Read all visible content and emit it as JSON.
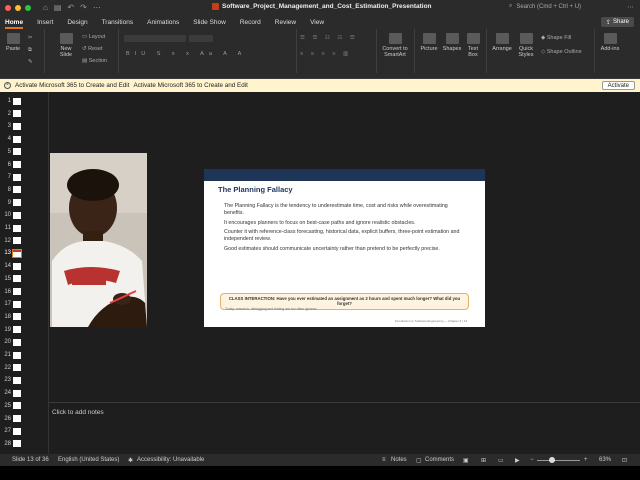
{
  "window": {
    "title": "Software_Project_Management_and_Cost_Estimation_Presentation",
    "search_placeholder": "Search (Cmd + Ctrl + U)"
  },
  "ribbon_tabs": [
    "Home",
    "Insert",
    "Design",
    "Transitions",
    "Animations",
    "Slide Show",
    "Record",
    "Review",
    "View"
  ],
  "share_label": "Share",
  "ribbon": {
    "paste": "Paste",
    "new_slide": "New Slide",
    "layout": "Layout",
    "reset": "Reset",
    "section": "Section",
    "convert": "Convert to SmartArt",
    "picture": "Picture",
    "shapes": "Shapes",
    "text_box": "Text Box",
    "arrange": "Arrange",
    "quick_styles": "Quick Styles",
    "shape_fill": "Shape Fill",
    "shape_outline": "Shape Outline",
    "add_ins": "Add-ins"
  },
  "infobar": {
    "message": "Activate Microsoft 365 to Create and Edit",
    "message2": "Activate Microsoft 365 to Create and Edit",
    "button": "Activate"
  },
  "thumbnails": [
    "1",
    "2",
    "3",
    "4",
    "5",
    "6",
    "7",
    "8",
    "9",
    "10",
    "11",
    "12",
    "13",
    "14",
    "15",
    "16",
    "17",
    "18",
    "19",
    "20",
    "21",
    "22",
    "23",
    "24",
    "25",
    "26",
    "27",
    "28"
  ],
  "selected_slide": 13,
  "slide": {
    "title": "The Planning Fallacy",
    "bullets": [
      "The Planning Fallacy is the tendency to underestimate time, cost and risks while overestimating benefits.",
      "It encourages planners to focus on best-case paths and ignore realistic obstacles.",
      "Counter it with reference-class forecasting, historical data, explicit buffers, three-point estimation and independent review.",
      "Good estimates should communicate uncertainty rather than pretend to be perfectly precise."
    ],
    "interaction_title": "CLASS INTERACTION: Have you ever estimated an assignment as 2 hours and spent much longer? What did you forget?",
    "interaction_sub": "Today, research, debugging and testing are too often ignored.",
    "footer": "Introduction to Software Engineering — Chapter 3 | 13"
  },
  "notes_placeholder": "Click to add notes",
  "status": {
    "slide_of": "Slide 13 of 36",
    "language": "English (United States)",
    "accessibility": "Accessibility: Unavailable",
    "notes": "Notes",
    "comments": "Comments",
    "zoom": "63%"
  },
  "colors": {
    "accent": "#e8731f",
    "slide_band": "#1f3558",
    "infobar_bg": "#fff4ce"
  }
}
